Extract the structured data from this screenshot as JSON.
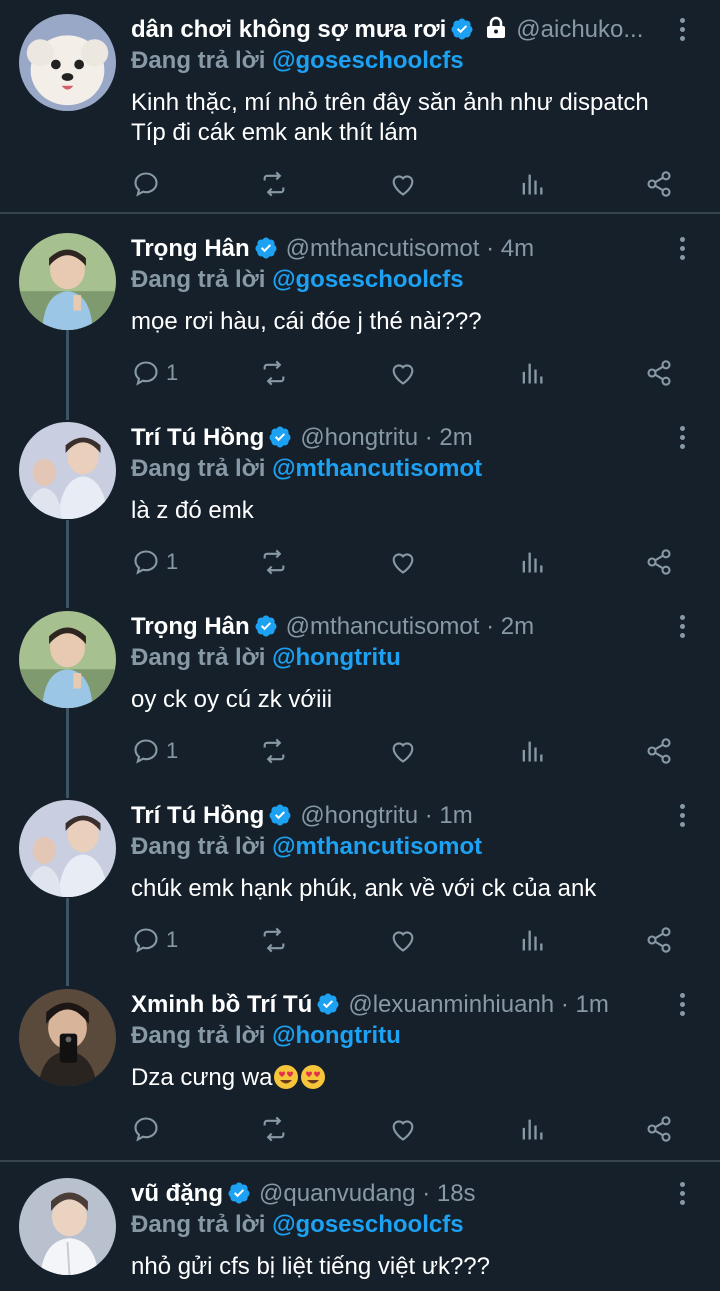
{
  "replying_label": "Đang trả lời",
  "tweets": [
    {
      "name": "dân chơi không sợ mưa rơi",
      "handle": "@aichuko...",
      "time": "",
      "protected": true,
      "reply_to": "@goseschoolcfs",
      "text": "Kinh thặc, mí nhỏ trên đây săn ảnh như dispatch\nTíp đi cák emk ank thít lám",
      "reply_count": "",
      "avatar": "dog-avatar"
    },
    {
      "name": "Trọng Hân",
      "handle": "@mthancutisomot",
      "time": "4m",
      "protected": false,
      "reply_to": "@goseschoolcfs",
      "text": "mọe rơi hàu, cái đóe j thé nài???",
      "reply_count": "1",
      "avatar": "user-avatar-a"
    },
    {
      "name": "Trí Tú Hồng",
      "handle": "@hongtritu",
      "time": "2m",
      "protected": false,
      "reply_to": "@mthancutisomot",
      "text": "là z đó emk",
      "reply_count": "1",
      "avatar": "user-avatar-b"
    },
    {
      "name": "Trọng Hân",
      "handle": "@mthancutisomot",
      "time": "2m",
      "protected": false,
      "reply_to": "@hongtritu",
      "text": "oy ck oy cú zk vớiii",
      "reply_count": "1",
      "avatar": "user-avatar-a"
    },
    {
      "name": "Trí Tú Hồng",
      "handle": "@hongtritu",
      "time": "1m",
      "protected": false,
      "reply_to": "@mthancutisomot",
      "text": "chúk emk hạnk phúk, ank về với ck của ank",
      "reply_count": "1",
      "avatar": "user-avatar-b"
    },
    {
      "name": "Xminh bồ Trí Tú",
      "handle": "@lexuanminhiuanh",
      "time": "1m",
      "protected": false,
      "reply_to": "@hongtritu",
      "text": "Dza cưng wa",
      "emojis": "😍😍",
      "reply_count": "",
      "avatar": "user-avatar-c"
    },
    {
      "name": "vũ đặng",
      "handle": "@quanvudang",
      "time": "18s",
      "protected": false,
      "reply_to": "@goseschoolcfs",
      "text": "nhỏ gửi cfs bị liệt tiếng việt ưk???",
      "reply_count": "",
      "avatar": "user-avatar-d"
    }
  ],
  "colors": {
    "background": "#15202b",
    "accent": "#1da1f2",
    "muted": "#8899a6",
    "divider": "#38444d"
  },
  "icons": [
    "reply-icon",
    "retweet-icon",
    "like-icon",
    "analytics-icon",
    "share-icon",
    "verified-icon",
    "lock-icon",
    "more-icon"
  ]
}
